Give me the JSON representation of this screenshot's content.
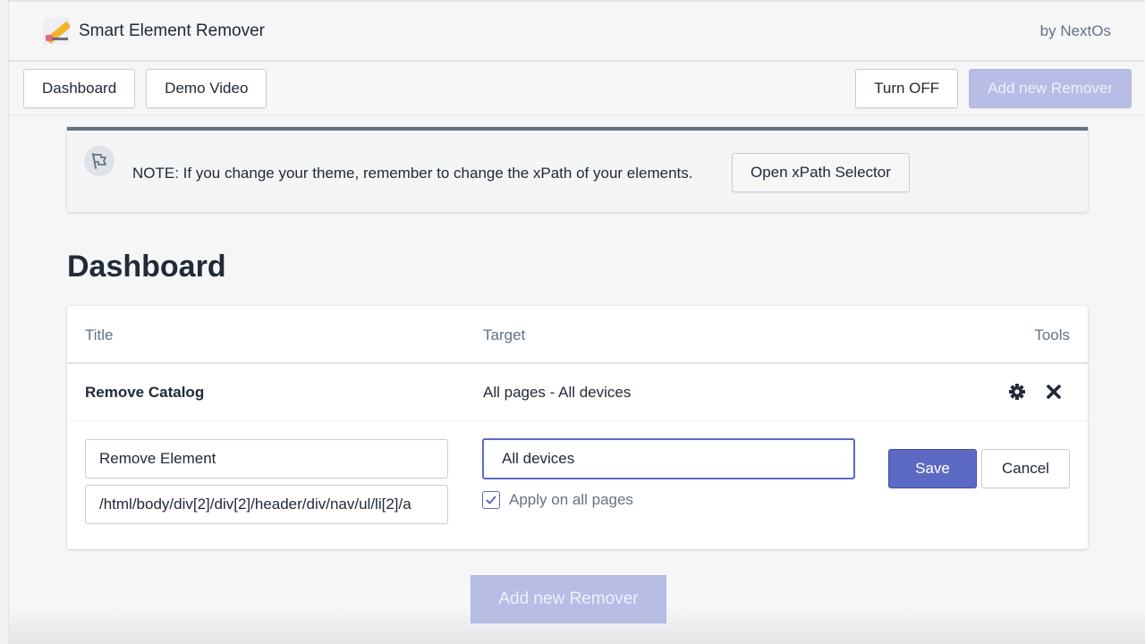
{
  "app": {
    "title": "Smart Element Remover",
    "vendor": "by NextOs",
    "logo": "eraser-pencil-logo"
  },
  "toolbar": {
    "dashboard_label": "Dashboard",
    "demo_video_label": "Demo Video",
    "turn_off_label": "Turn OFF",
    "add_new_label": "Add new Remover"
  },
  "banner": {
    "icon": "flag-icon",
    "note": "NOTE: If you change your theme, remember to change the xPath of your elements.",
    "button_label": "Open xPath Selector"
  },
  "page": {
    "title": "Dashboard"
  },
  "table": {
    "headers": [
      "Title",
      "Target",
      "Tools"
    ],
    "rows": [
      {
        "title": "Remove Catalog",
        "target": "All pages - All devices",
        "tools": [
          "gear-icon",
          "close-icon"
        ]
      }
    ]
  },
  "editor": {
    "name_value": "Remove Element",
    "xpath_value": "/html/body/div[2]/div[2]/header/div/nav/ul/li[2]/a",
    "device_value": "All devices",
    "apply_all_pages_label": "Apply on all pages",
    "apply_all_pages_checked": true,
    "save_label": "Save",
    "cancel_label": "Cancel"
  },
  "footer": {
    "add_new_label": "Add new Remover"
  },
  "colors": {
    "accent": "#5c6ac4",
    "accent_disabled": "#b7bde5",
    "banner_border": "#637381",
    "text": "#212b36",
    "muted": "#637381"
  }
}
